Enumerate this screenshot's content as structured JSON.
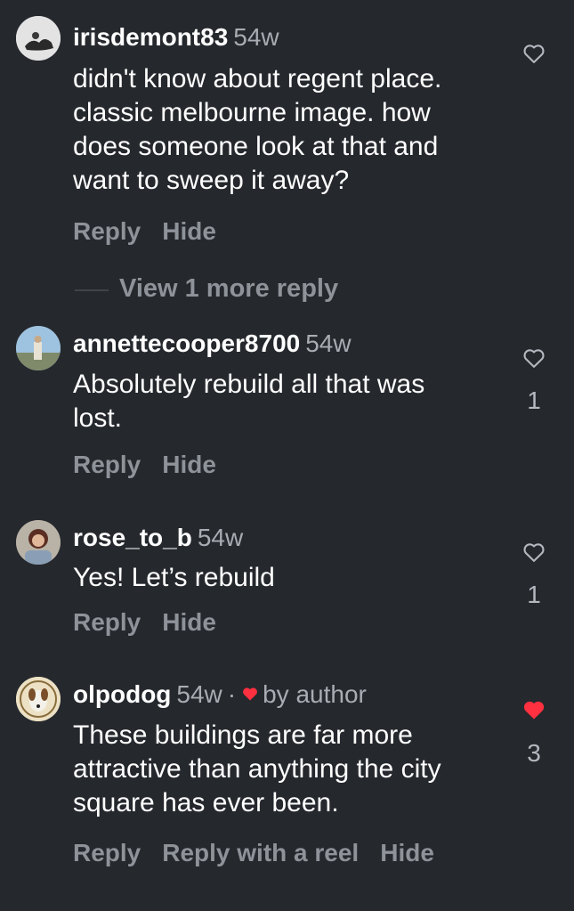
{
  "comments": [
    {
      "username": "irisdemont83",
      "timestamp": "54w",
      "lines": [
        "didn't know about regent place.",
        "classic melbourne image. how",
        "does someone look at that and",
        "want to sweep it away?"
      ],
      "actions": [
        "Reply",
        "Hide"
      ],
      "likes": "",
      "liked": false
    },
    {
      "username": "annettecooper8700",
      "timestamp": "54w",
      "lines": [
        "Absolutely rebuild all that was",
        "lost."
      ],
      "actions": [
        "Reply",
        "Hide"
      ],
      "likes": "1",
      "liked": false
    },
    {
      "username": "rose_to_b",
      "timestamp": "54w",
      "lines": [
        "Yes! Let’s rebuild"
      ],
      "actions": [
        "Reply",
        "Hide"
      ],
      "likes": "1",
      "liked": false
    },
    {
      "username": "olpodog",
      "timestamp": "54w",
      "separator": "·",
      "author_badge": "by author",
      "lines": [
        "These buildings are far more",
        "attractive than anything the city",
        "square has ever been."
      ],
      "actions": [
        "Reply",
        "Reply with a reel",
        "Hide"
      ],
      "likes": "3",
      "liked": true
    }
  ],
  "view_more_replies": "View 1 more reply",
  "icons": {
    "like": "heart-outline-icon",
    "liked": "heart-filled-icon"
  },
  "colors": {
    "background": "#25282d",
    "text": "#ffffff",
    "muted": "#a8acb3",
    "action": "#8e9299",
    "heart_red": "#ff3040"
  }
}
